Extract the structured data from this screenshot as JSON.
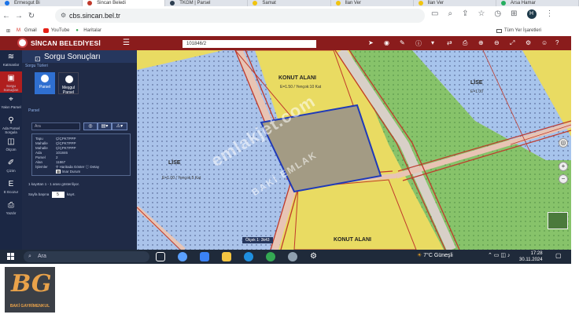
{
  "browser": {
    "tabs": [
      {
        "title": "Ermesgut Bi",
        "color": "#1a73e8"
      },
      {
        "title": "Sincan Beledi",
        "color": "#c0392b",
        "active": true
      },
      {
        "title": "TKGM | Parsel",
        "color": "#2c3e50"
      },
      {
        "title": "Samat",
        "color": "#f1c40f"
      },
      {
        "title": "İlan Ver",
        "color": "#f1c40f"
      },
      {
        "title": "İlan Ver",
        "color": "#f1c40f"
      },
      {
        "title": "Arsa Hamar",
        "color": "#27ae60"
      }
    ],
    "url": "cbs.sincan.bel.tr",
    "profile_initial": "H",
    "bookmarks": [
      {
        "label": "Gmail",
        "icon": "gmail-icon"
      },
      {
        "label": "YouTube",
        "icon": "youtube-icon"
      },
      {
        "label": "Haritalar",
        "icon": "maps-icon"
      }
    ],
    "all_bookmarks_label": "Tüm Yer İşaretleri"
  },
  "app": {
    "brand": "SİNCAN BELEDİYESİ",
    "search_value": "101846/2",
    "rail_items": [
      {
        "label": "Katmanlar",
        "icon": "layers-icon"
      },
      {
        "label": "Sorgu Sonuçları",
        "icon": "query-icon",
        "active": true
      },
      {
        "label": "Yakın Parsel",
        "icon": "nearby-parcel-icon"
      },
      {
        "label": "Ada Parsel Sorgula",
        "icon": "parcel-search-icon"
      },
      {
        "label": "Ölçüm",
        "icon": "measure-icon"
      },
      {
        "label": "Çizim",
        "icon": "draw-icon"
      },
      {
        "label": "E Ecozur",
        "icon": "ecozur-icon"
      },
      {
        "label": "Yazdır",
        "icon": "print-icon"
      }
    ]
  },
  "panel": {
    "title": "Sorgu Sonuçları",
    "query_types_label": "Sorgu Türleri",
    "types": [
      {
        "label": "Parsel"
      },
      {
        "label": "Meşgul Parsel"
      }
    ],
    "section_label": "Parsel",
    "search_placeholder": "Ara",
    "result": {
      "rows": [
        {
          "key": "Tapu",
          "value": "ÇİÇPKTPPP"
        },
        {
          "key": "Mahalle",
          "value": "ÇİÇPKTPPP"
        },
        {
          "key": "Mahalle",
          "value": "ÇİÇPKTPPP"
        },
        {
          "key": "Ada",
          "value": "101846"
        },
        {
          "key": "Parsel",
          "value": "2"
        },
        {
          "key": "Alan",
          "value": "11867"
        },
        {
          "key": "İşlemler",
          "value": ""
        }
      ],
      "link_map": "Haritada Göster",
      "link_detail": "Detay",
      "link_zoning": "İmar Durum"
    },
    "count_text": "1 kayıttan 1 - 1 arası gösteriliyor.",
    "pager_prefix": "Sayfa başına",
    "pager_value": "5",
    "pager_suffix": "kayıt."
  },
  "map": {
    "labels": [
      {
        "text": "KONUT ALANI",
        "sub": "E=1.50 / Yençok:10 Kat"
      },
      {
        "text": "LİSE",
        "sub": "E=1.00"
      },
      {
        "text": "LİSE",
        "sub": "E=1.00 / Yençok:5 Kat"
      },
      {
        "text": "KONUT ALANI",
        "sub": ""
      }
    ],
    "watermark": "emlakjet.com",
    "watermark2": "BAKİ EMLAK",
    "scale_text": "Ölçek 1: 3k43"
  },
  "taskbar": {
    "search_placeholder": "Ara",
    "weather": "7°C  Güneşli",
    "time": "17:28",
    "date": "30.11.2024"
  },
  "watermark_logo": {
    "letters": "BG",
    "name": "BAKİ GAYRİMENKUL"
  }
}
